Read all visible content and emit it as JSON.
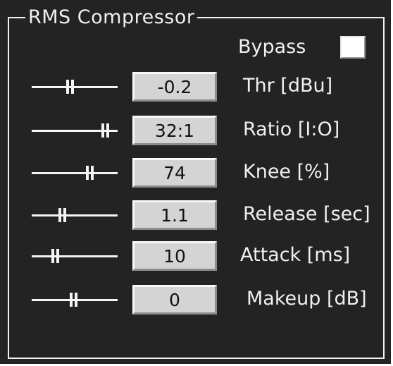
{
  "group": {
    "title": "RMS Compressor"
  },
  "bypass": {
    "label": "Bypass",
    "checked": false
  },
  "params": [
    {
      "id": "threshold",
      "label": "Thr [dBu]",
      "value": "-0.2",
      "slider_fraction": 0.45
    },
    {
      "id": "ratio",
      "label": "Ratio [I:O]",
      "value": "32:1",
      "slider_fraction": 0.86
    },
    {
      "id": "knee",
      "label": "Knee [%]",
      "value": "74",
      "slider_fraction": 0.68
    },
    {
      "id": "release",
      "label": "Release [sec]",
      "value": "1.1",
      "slider_fraction": 0.36
    },
    {
      "id": "attack",
      "label": "Attack [ms]",
      "value": "10",
      "slider_fraction": 0.28
    },
    {
      "id": "makeup",
      "label": "Makeup [dB]",
      "value": "0",
      "slider_fraction": 0.49
    }
  ]
}
